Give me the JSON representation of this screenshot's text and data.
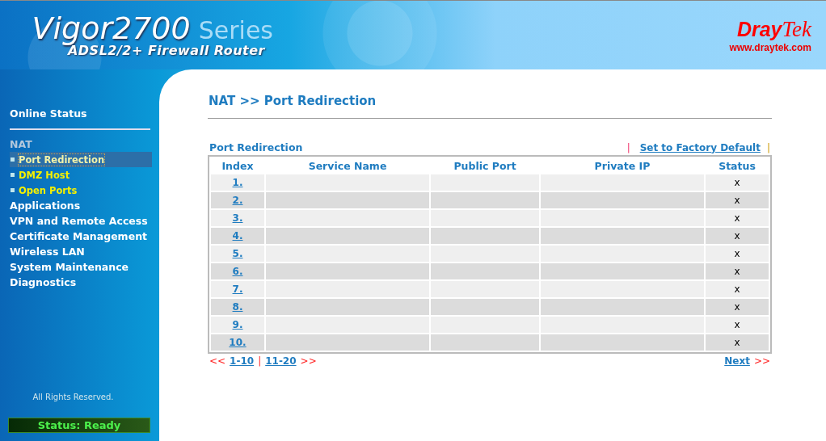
{
  "header": {
    "title": "Vigor2700",
    "series": "Series",
    "subtitle": "ADSL2/2+ Firewall Router"
  },
  "logo": {
    "brand_bold": "Dray",
    "brand_serif": "Tek",
    "url": "www.draytek.com"
  },
  "sidebar": {
    "top_item": "Online Status",
    "menu": [
      {
        "label": "NAT",
        "expanded": true,
        "children": [
          {
            "label": "Port Redirection",
            "selected": true
          },
          {
            "label": "DMZ Host",
            "selected": false
          },
          {
            "label": "Open Ports",
            "selected": false
          }
        ]
      },
      {
        "label": "Applications",
        "expanded": false
      },
      {
        "label": "VPN and Remote Access",
        "expanded": false
      },
      {
        "label": "Certificate Management",
        "expanded": false
      },
      {
        "label": "Wireless LAN",
        "expanded": false
      },
      {
        "label": "System Maintenance",
        "expanded": false
      },
      {
        "label": "Diagnostics",
        "expanded": false
      }
    ],
    "copyright": "All Rights Reserved.",
    "status": "Status: Ready"
  },
  "main": {
    "page_title": "NAT >> Port Redirection",
    "section_title": "Port Redirection",
    "separator_left": "|",
    "factory_default_link": "Set to Factory Default",
    "separator_right": "|",
    "table": {
      "columns": [
        "Index",
        "Service Name",
        "Public Port",
        "Private IP",
        "Status"
      ],
      "rows": [
        {
          "index": "1.",
          "status": "x"
        },
        {
          "index": "2.",
          "status": "x"
        },
        {
          "index": "3.",
          "status": "x"
        },
        {
          "index": "4.",
          "status": "x"
        },
        {
          "index": "5.",
          "status": "x"
        },
        {
          "index": "6.",
          "status": "x"
        },
        {
          "index": "7.",
          "status": "x"
        },
        {
          "index": "8.",
          "status": "x"
        },
        {
          "index": "9.",
          "status": "x"
        },
        {
          "index": "10.",
          "status": "x"
        }
      ]
    },
    "pagination": {
      "prev_mark": "<<",
      "pages": [
        "1-10",
        "11-20"
      ],
      "page_separator": "|",
      "next_mark": ">>",
      "next_link": "Next",
      "next_arrow": ">>"
    }
  }
}
